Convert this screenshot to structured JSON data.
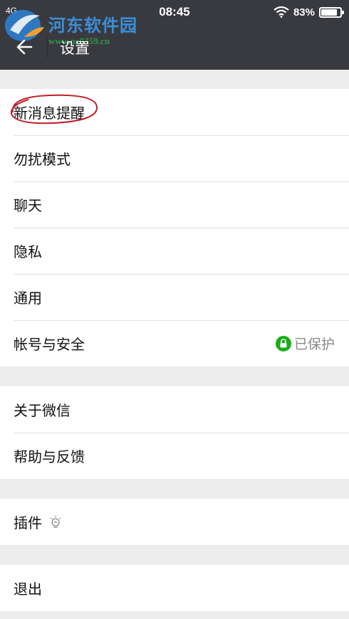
{
  "status_bar": {
    "signal": "4G",
    "time": "08:45",
    "battery": "83%",
    "battery_level": 0.83
  },
  "watermark": {
    "name": "河东软件园",
    "url": "www.pc0359.cn"
  },
  "nav": {
    "title": "设置"
  },
  "groups": [
    {
      "items": [
        {
          "label": "新消息提醒"
        },
        {
          "label": "勿扰模式"
        },
        {
          "label": "聊天"
        },
        {
          "label": "隐私"
        },
        {
          "label": "通用"
        },
        {
          "label": "帐号与安全",
          "status": "已保护"
        }
      ]
    },
    {
      "items": [
        {
          "label": "关于微信"
        },
        {
          "label": "帮助与反馈"
        }
      ]
    },
    {
      "items": [
        {
          "label": "插件"
        }
      ]
    },
    {
      "items": [
        {
          "label": "退出"
        }
      ]
    }
  ],
  "colors": {
    "nav_background": "#393a3f",
    "page_background": "#ededed",
    "secure_green": "#1aad19",
    "annotation_red": "#c0202a"
  }
}
